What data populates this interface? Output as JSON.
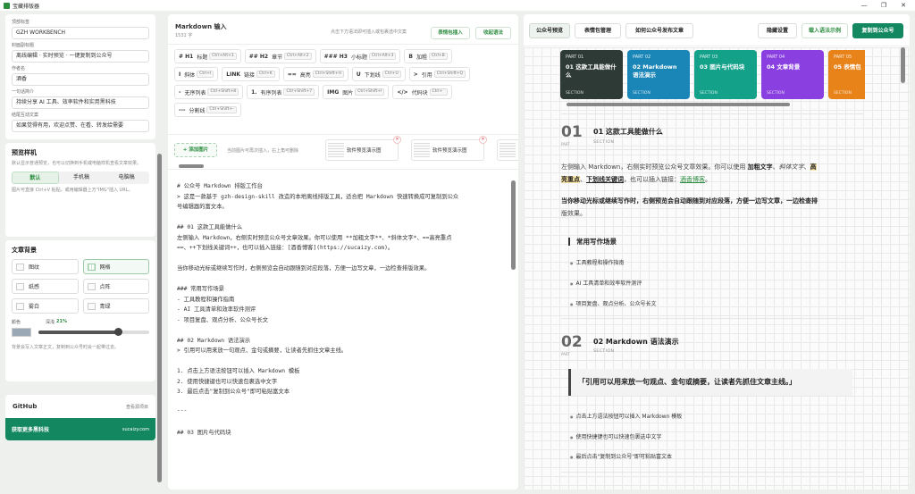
{
  "window": {
    "title": "宝藏排版器",
    "minimize": "—",
    "maximize": "❐",
    "close": "✕"
  },
  "sidebar": {
    "fields": [
      {
        "label": "顶部标签",
        "value": "GZH WORKBENCH"
      },
      {
        "label": "封面副标题",
        "value": "离线编辑 · 实时预览 · 一键复制到公众号"
      },
      {
        "label": "作者名",
        "value": "酒香"
      },
      {
        "label": "一句话简介",
        "value": "持续分享 AI 工具、效率软件和实用黑科技"
      },
      {
        "label": "结尾互动文案",
        "value": "如果觉得有用，欢迎点赞、在看、转发给需要"
      }
    ],
    "preview_style": {
      "title": "预览样机",
      "hint": "默认显示普通预览，也可以切换到手机或电脑样机查看文章效果。",
      "options": [
        "默认",
        "手机稿",
        "电脑稿"
      ],
      "selected": "默认",
      "hint2": "图片可直接 Ctrl+V 粘贴，或用编辑器上方\"IMG\"插入 URL。"
    },
    "background": {
      "title": "文章背景",
      "options": [
        "图纹",
        "网格",
        "纸感",
        "点阵",
        "雾白",
        "青绿"
      ],
      "selected": "网格",
      "color_label": "颜色",
      "depth_label": "深浅",
      "depth_value": "21%",
      "depth": 0.72,
      "color": "#9aa7b5",
      "hint": "背景会写入文章正文，复制到公众号时会一起带过去。"
    },
    "github": {
      "title": "GitHub",
      "link": "查看源项目"
    },
    "promo": {
      "title": "获取更多黑科技",
      "site": "sucaizy.com"
    }
  },
  "editor": {
    "title": "Markdown 输入",
    "count": "1531 字",
    "tip": "点击下方语法即可插入或包裹选中文案",
    "btn_emoji": "表情包插入",
    "btn_collapse": "收起语法",
    "toolbar": [
      [
        {
          "icon": "# H1",
          "label": "标题",
          "key": "Ctrl+Alt+1"
        },
        {
          "icon": "## H2",
          "label": "章节",
          "key": "Ctrl+Alt+2"
        },
        {
          "icon": "### H3",
          "label": "小标题",
          "key": "Ctrl+Alt+3"
        },
        {
          "icon": "B",
          "label": "加粗",
          "key": "Ctrl+B"
        }
      ],
      [
        {
          "icon": "I",
          "label": "斜体",
          "key": "Ctrl+I"
        },
        {
          "icon": "LINK",
          "label": "链接",
          "key": "Ctrl+K"
        },
        {
          "icon": "==",
          "label": "高亮",
          "key": "Ctrl+Shift+H"
        },
        {
          "icon": "U",
          "label": "下划线",
          "key": "Ctrl+U"
        },
        {
          "icon": ">",
          "label": "引用",
          "key": "Ctrl+Shift+Q"
        }
      ],
      [
        {
          "icon": "-",
          "label": "无序列表",
          "key": "Ctrl+Shift+8"
        },
        {
          "icon": "1.",
          "label": "有序列表",
          "key": "Ctrl+Shift+7"
        },
        {
          "icon": "IMG",
          "label": "图片",
          "key": "Ctrl+Shift+I"
        },
        {
          "icon": "</>",
          "label": "代码块",
          "key": "Ctrl+`"
        }
      ],
      [
        {
          "icon": "---",
          "label": "分割线",
          "key": "Ctrl+Shift+-"
        }
      ]
    ],
    "add_image": "+ 添加图片",
    "image_hint": "当前图片可再次插入，右上角可删除",
    "thumbs": [
      "软件预览演示图",
      "软件预览演示图"
    ],
    "lines": [
      "# 公众号 Markdown 排版工作台",
      "> 这是一款基于 gzh-design-skill 改造的本地离线排版工具，适合把 Markdown 快速转换成可复制到公众",
      "号编辑器的富文本。",
      "",
      "## 01 这款工具能做什么",
      "左侧输入 Markdown，右侧实时预览公众号文章效果。你可以使用 **加粗文字**、*斜体文字*、==高亮重点",
      "==、++下划线关键词++，也可以插入链接：[酒香博客](https://sucaizy.com)。",
      "",
      "当你移动光标或继续写作时，右侧预览会自动跟随到对应段落，方便一边写文章，一边检查排版效果。",
      "",
      "### 常用写作场景",
      "- 工具教程和操作指南",
      "- AI 工具清单和效率软件测评",
      "- 项目复盘、观点分析、公众号长文",
      "",
      "## 02 Markdown 语法演示",
      "> 引用可以用来放一句观点、金句或摘要，让读者先抓住文章主线。",
      "",
      "1. 点击上方语法按钮可以插入 Markdown 模板",
      "2. 使用快捷键也可以快速包裹选中文字",
      "3. 最后点击\"复制到公众号\"即可粘贴富文本",
      "",
      "---",
      "",
      "## 03 图片与代码块"
    ]
  },
  "preview": {
    "tabs": [
      "公众号预览",
      "表情包管理",
      "如何公众号发布文章"
    ],
    "active_tab": "公众号预览",
    "btn_hide": "隐藏设置",
    "btn_demo": "载入语法示例",
    "btn_copy": "复制到公众号",
    "toc": [
      {
        "part": "PART 01",
        "title": "01 这款工具能做什么",
        "sub": "SECTION",
        "color": "#2d3a36"
      },
      {
        "part": "PART 02",
        "title": "02 Markdown 语法演示",
        "sub": "SECTION",
        "color": "#1a86b8"
      },
      {
        "part": "PART 03",
        "title": "03 图片与代码块",
        "sub": "SECTION",
        "color": "#13a18a"
      },
      {
        "part": "PART 04",
        "title": "04 文章背景",
        "sub": "SECTION",
        "color": "#8a3fe0"
      },
      {
        "part": "PART 05",
        "title": "05 表情包",
        "sub": "SECTION",
        "color": "#e8831a"
      }
    ],
    "s1": {
      "num": "01",
      "part": "PART",
      "title": "01 这款工具能做什么",
      "sec": "SECTION"
    },
    "p1a": "左侧输入 Markdown，右侧实时预览公众号文章效果。你可以使用",
    "p1b": "加粗文字",
    "p1c": "、",
    "p1d": "斜体文字",
    "p1e": "、",
    "p1f": "高",
    "p2a": "亮重点",
    "p2b": "、",
    "p2c": "下划线关键词",
    "p2d": "，也可以插入链接：",
    "p2e": "酒香博客",
    "p2f": "。",
    "p3": "当你移动光标或继续写作时，右侧预览会自动跟随到对应段落，方便一边写文章，一边检查排",
    "p3b": "版效果。",
    "sub1": "常用写作场景",
    "items1": [
      "工具教程和操作指南",
      "AI 工具清单和效率软件测评",
      "项目复盘、观点分析、公众号长文"
    ],
    "s2": {
      "num": "02",
      "part": "PART",
      "title": "02 Markdown 语法演示",
      "sec": "SECTION"
    },
    "quote": "「引用可以用来放一句观点、金句或摘要，让读者先抓住文章主线。」",
    "items2": [
      "点击上方语法按钮可以插入 Markdown 模板",
      "使用快捷键也可以快速包裹选中文字",
      "最后点击\"复制到公众号\"即可粘贴富文本"
    ]
  }
}
